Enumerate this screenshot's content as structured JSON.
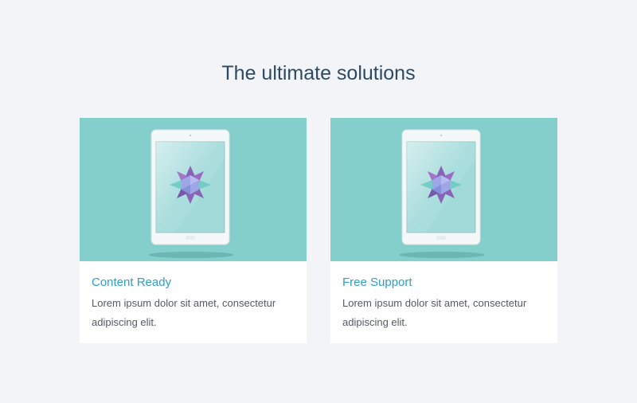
{
  "section": {
    "title": "The ultimate solutions"
  },
  "cards": [
    {
      "title": "Content Ready",
      "text": "Lorem ipsum dolor sit amet, consectetur adipiscing elit.",
      "image_icon": "tablet-icon"
    },
    {
      "title": "Free Support",
      "text": "Lorem ipsum dolor sit amet, consectetur adipiscing elit.",
      "image_icon": "tablet-icon"
    }
  ],
  "colors": {
    "page_background": "#f3f4f8",
    "title": "#2d4a63",
    "card_accent": "#84cfcb",
    "link": "#2e9fc8",
    "body_text": "#555a60"
  }
}
